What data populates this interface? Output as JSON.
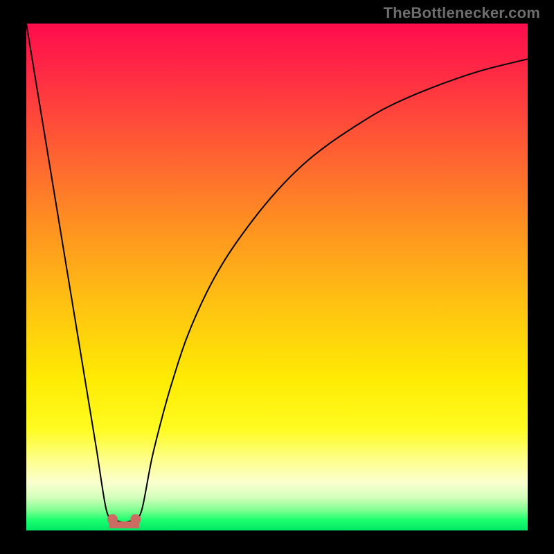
{
  "attribution": "TheBottlenecker.com",
  "chart_data": {
    "type": "line",
    "title": "",
    "xlabel": "",
    "ylabel": "",
    "xlim": [
      0,
      100
    ],
    "ylim": [
      0,
      100
    ],
    "series": [
      {
        "name": "bottleneck-curve",
        "x": [
          0,
          2,
          4,
          6,
          8,
          10,
          12,
          14,
          15.9,
          17.2,
          18.5,
          19.5,
          20.5,
          21.8,
          23.1,
          25,
          27,
          29,
          32,
          36,
          40,
          45,
          50,
          55,
          60,
          66,
          72,
          80,
          90,
          100
        ],
        "y": [
          100,
          88,
          76,
          64,
          52,
          40,
          28,
          16,
          4.3,
          2.2,
          1.8,
          1.6,
          1.8,
          2.2,
          4.3,
          14,
          22,
          29,
          38,
          47,
          54,
          61,
          67,
          72,
          76,
          80,
          83.5,
          87,
          90.5,
          93
        ]
      }
    ],
    "markers": [
      {
        "name": "left-dot",
        "x": 17.2,
        "y": 2.2
      },
      {
        "name": "right-dot",
        "x": 21.8,
        "y": 2.2
      }
    ],
    "background_gradient": {
      "stops": [
        {
          "offset": 0.0,
          "color": "#ff0c4d"
        },
        {
          "offset": 0.1,
          "color": "#ff2b44"
        },
        {
          "offset": 0.24,
          "color": "#ff5b34"
        },
        {
          "offset": 0.38,
          "color": "#ff8b23"
        },
        {
          "offset": 0.55,
          "color": "#ffc112"
        },
        {
          "offset": 0.7,
          "color": "#feeb03"
        },
        {
          "offset": 0.8,
          "color": "#fffb20"
        },
        {
          "offset": 0.86,
          "color": "#feff8a"
        },
        {
          "offset": 0.905,
          "color": "#fbffce"
        },
        {
          "offset": 0.935,
          "color": "#d3ffbb"
        },
        {
          "offset": 0.96,
          "color": "#80ff91"
        },
        {
          "offset": 0.98,
          "color": "#1aff6e"
        },
        {
          "offset": 1.0,
          "color": "#00e765"
        }
      ]
    }
  }
}
